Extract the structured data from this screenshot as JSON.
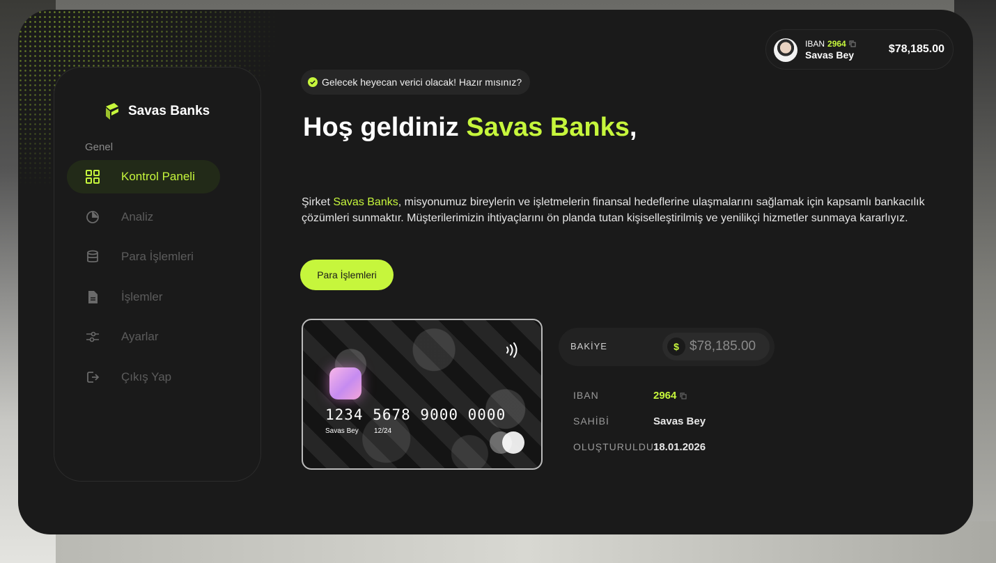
{
  "brand": {
    "name": "Savas Banks"
  },
  "sidebar": {
    "section_label": "Genel",
    "items": [
      {
        "label": "Kontrol Paneli",
        "icon": "dashboard-grid-icon",
        "active": true
      },
      {
        "label": "Analiz",
        "icon": "pie-chart-icon",
        "active": false
      },
      {
        "label": "Para İşlemleri",
        "icon": "database-icon",
        "active": false
      },
      {
        "label": "İşlemler",
        "icon": "document-icon",
        "active": false
      },
      {
        "label": "Ayarlar",
        "icon": "sliders-icon",
        "active": false
      },
      {
        "label": "Çıkış Yap",
        "icon": "logout-icon",
        "active": false
      }
    ]
  },
  "profile": {
    "iban_label": "IBAN",
    "iban": "2964",
    "name": "Savas Bey",
    "balance": "$78,185.00"
  },
  "hero": {
    "notice": "Gelecek heyecan verici olacak! Hazır mısınız?",
    "headline_prefix": "Hoş geldiniz ",
    "headline_accent": "Savas Banks",
    "headline_suffix": ",",
    "description_prefix": "Şirket ",
    "description_accent": "Savas Banks",
    "description_rest": ", misyonumuz bireylerin ve işletmelerin finansal hedeflerine ulaşmalarını sağlamak için kapsamlı bankacılık çözümleri sunmaktır. Müşterilerimizin ihtiyaçlarını ön planda tutan kişiselleştirilmiş ve yenilikçi hizmetler sunmaya kararlıyız.",
    "cta_label": "Para İşlemleri"
  },
  "card": {
    "number": "1234 5678 9000 0000",
    "holder": "Savas Bey",
    "expiry": "12/24"
  },
  "account": {
    "balance_label": "BAKİYE",
    "currency_symbol": "$",
    "balance": "$78,185.00",
    "rows": [
      {
        "label": "IBAN",
        "value": "2964"
      },
      {
        "label": "SAHİBİ",
        "value": "Savas Bey"
      },
      {
        "label": "OLUŞTURULDU",
        "value": "18.01.2026"
      }
    ]
  },
  "colors": {
    "accent": "#c6f63c",
    "panel": "#1a1a1a"
  }
}
